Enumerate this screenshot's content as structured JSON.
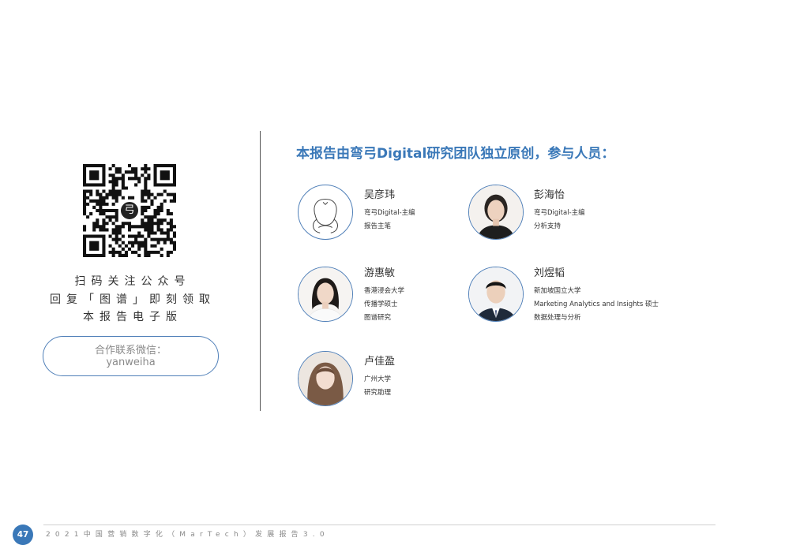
{
  "left": {
    "qr_logo_char": "弓",
    "scan_lines": [
      "扫码关注公众号",
      "回复「图谱」即刻领取",
      "本报告电子版"
    ],
    "contact": {
      "label": "合作联系微信：",
      "value": "yanweiha"
    }
  },
  "heading": "本报告由弯弓Digital研究团队独立原创，参与人员：",
  "members": [
    {
      "name": "吴彦玮",
      "lines": [
        "弯弓Digital-主编",
        "报告主笔"
      ]
    },
    {
      "name": "彭海怡",
      "lines": [
        "弯弓Digital-主编",
        "分析支持"
      ]
    },
    {
      "name": "游惠敏",
      "lines": [
        "香港浸会大学",
        "传播学硕士",
        "图谱研究"
      ]
    },
    {
      "name": "刘煜韬",
      "lines": [
        "新加坡国立大学",
        "Marketing Analytics and Insights 硕士",
        "数据处理与分析"
      ]
    },
    {
      "name": "卢佳盈",
      "lines": [
        "广州大学",
        "研究助理"
      ]
    }
  ],
  "footer": {
    "page_number": "47",
    "text": "2021中国营销数字化（MarTech）发展报告3.0"
  },
  "colors": {
    "accent": "#3a78b8",
    "avatar_border": "#4f7fb8"
  }
}
